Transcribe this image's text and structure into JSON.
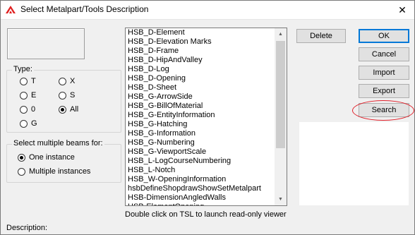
{
  "window": {
    "title": "Select Metalpart/Tools Description"
  },
  "type_group": {
    "label": "Type:",
    "options": [
      "T",
      "X",
      "E",
      "S",
      "0",
      "All",
      "G"
    ],
    "selected": "All"
  },
  "beams_group": {
    "label": "Select multiple beams for:",
    "options": [
      "One instance",
      "Multiple instances"
    ],
    "selected": "One instance"
  },
  "tsl_list": {
    "items": [
      "HSB_D-Element",
      "HSB_D-Elevation Marks",
      "HSB_D-Frame",
      "HSB_D-HipAndValley",
      "HSB_D-Log",
      "HSB_D-Opening",
      "HSB_D-Sheet",
      "HSB_G-ArrowSide",
      "HSB_G-BillOfMaterial",
      "HSB_G-EntityInformation",
      "HSB_G-Hatching",
      "HSB_G-Information",
      "HSB_G-Numbering",
      "HSB_G-ViewportScale",
      "HSB_L-LogCourseNumbering",
      "HSB_L-Notch",
      "HSB_W-OpeningInformation",
      "hsbDefineShopdrawShowSetMetalpart",
      "HSB-DimensionAngledWalls",
      "HSB-ElementOpening"
    ]
  },
  "hint_text": "Double click on TSL to launch read-only viewer",
  "description_label": "Description:",
  "buttons": {
    "delete": "Delete",
    "ok": "OK",
    "cancel": "Cancel",
    "import": "Import",
    "export": "Export",
    "search": "Search"
  },
  "colors": {
    "highlight": "#e0202a",
    "accent": "#0078d7"
  }
}
